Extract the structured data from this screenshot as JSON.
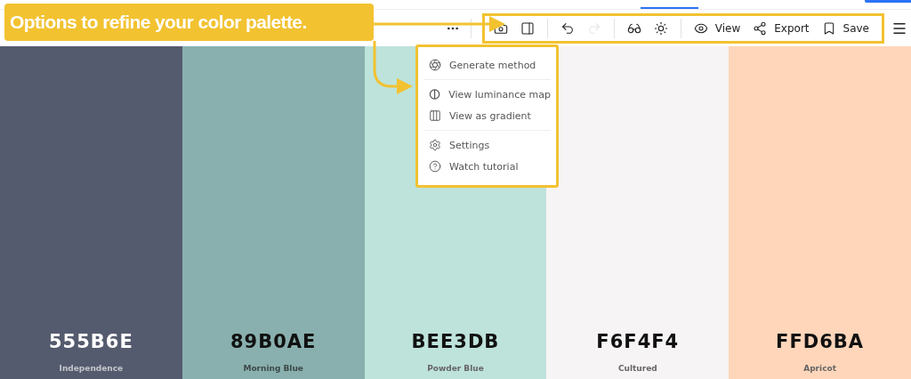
{
  "callout": {
    "text": "Options to refine your color palette."
  },
  "toolbar": {
    "items": [
      {
        "kind": "icon",
        "disabled": false
      },
      {
        "kind": "icon",
        "disabled": false
      },
      {
        "kind": "divider"
      },
      {
        "kind": "icon",
        "disabled": false
      },
      {
        "kind": "icon",
        "disabled": true
      },
      {
        "kind": "divider"
      },
      {
        "kind": "icon",
        "disabled": false
      },
      {
        "kind": "icon",
        "disabled": false
      },
      {
        "kind": "divider"
      },
      {
        "kind": "labeled",
        "label": "View",
        "disabled": false
      },
      {
        "kind": "labeled",
        "label": "Export",
        "disabled": false
      },
      {
        "kind": "labeled",
        "label": "Save",
        "disabled": false
      }
    ]
  },
  "menu": {
    "sections": [
      [
        {
          "label": "Generate method"
        }
      ],
      [
        {
          "label": "View luminance map"
        },
        {
          "label": "View as gradient"
        }
      ],
      [
        {
          "label": "Settings"
        },
        {
          "label": "Watch tutorial"
        }
      ]
    ]
  },
  "swatches": [
    {
      "hex": "555B6E",
      "name": "Independence",
      "color": "#555b6e"
    },
    {
      "hex": "89B0AE",
      "name": "Morning Blue",
      "color": "#89b0ae"
    },
    {
      "hex": "BEE3DB",
      "name": "Powder Blue",
      "color": "#bee3db"
    },
    {
      "hex": "F6F4F4",
      "name": "Cultured",
      "color": "#f6f4f4"
    },
    {
      "hex": "FFD6BA",
      "name": "Apricot",
      "color": "#ffd6ba"
    }
  ]
}
